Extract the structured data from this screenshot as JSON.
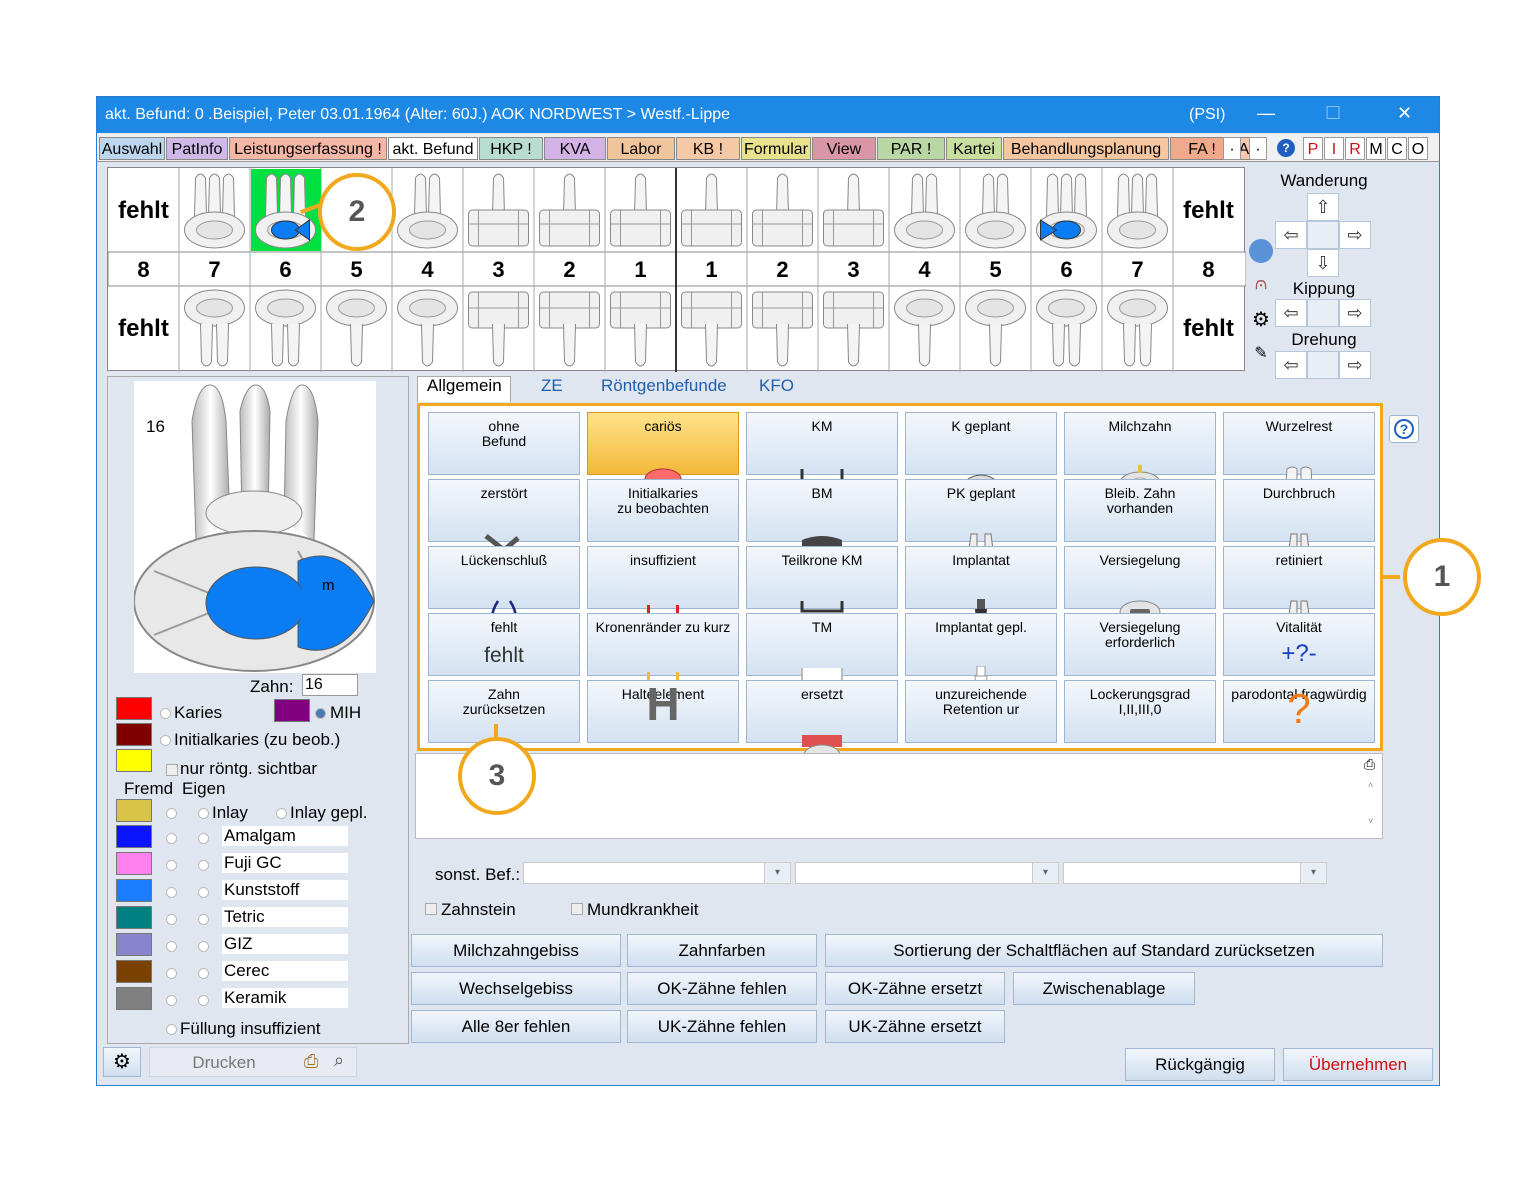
{
  "window": {
    "title": "akt. Befund: 0  .Beispiel, Peter  03.01.1964 (Alter: 60J.)  AOK NORDWEST > Westf.-Lippe",
    "psi": "(PSI)",
    "controls": [
      "—",
      "☐",
      "✕"
    ]
  },
  "tabs": [
    {
      "label": "Auswahl",
      "color": "#bcd6ee"
    },
    {
      "label": "PatInfo",
      "color": "#cfb8e8"
    },
    {
      "label": "Leistungserfassung !",
      "color": "#f4b7a6"
    },
    {
      "label": "akt. Befund",
      "color": "#ffffff"
    },
    {
      "label": "HKP !",
      "color": "#b8dccf"
    },
    {
      "label": "KVA",
      "color": "#d3b3e6"
    },
    {
      "label": "Labor",
      "color": "#f1c59b"
    },
    {
      "label": "KB !",
      "color": "#f5c9a6"
    },
    {
      "label": "Formular",
      "color": "#e9e28c"
    },
    {
      "label": "View",
      "color": "#d896a6"
    },
    {
      "label": "PAR !",
      "color": "#b8d7a4"
    },
    {
      "label": "Kartei",
      "color": "#c9df9d"
    },
    {
      "label": "Behandlungsplanung",
      "color": "#f5c6a0"
    },
    {
      "label": "FA !",
      "color": "#f0a98a"
    },
    {
      "label": "AI",
      "color": "#f7c7ae"
    }
  ],
  "tab_scroll": [
    "·",
    "·"
  ],
  "right_letters": [
    "P",
    "I",
    "R",
    "M",
    "C",
    "O"
  ],
  "chart": {
    "missing_label": "fehlt",
    "numbers": [
      "8",
      "7",
      "6",
      "5",
      "4",
      "3",
      "2",
      "1",
      "1",
      "2",
      "3",
      "4",
      "5",
      "6",
      "7",
      "8"
    ]
  },
  "movement": {
    "wanderung": "Wanderung",
    "kippung": "Kippung",
    "drehung": "Drehung"
  },
  "tooth_detail": {
    "number": "16",
    "surface_label": "m",
    "zahn_label": "Zahn:",
    "zahn_value": "16"
  },
  "legend": {
    "karies": "Karies",
    "mih": "MIH",
    "initialkaries": "Initialkaries (zu beob.)",
    "nur_roentg": "nur röntg. sichtbar",
    "fremd": "Fremd",
    "eigen": "Eigen",
    "inlay": "Inlay",
    "inlay_gepl": "Inlay gepl.",
    "materials": [
      {
        "name": "Amalgam",
        "color": "#0a14ff"
      },
      {
        "name": "Fuji GC",
        "color": "#ff80ee"
      },
      {
        "name": "Kunststoff",
        "color": "#1a7dff"
      },
      {
        "name": "Tetric",
        "color": "#008080"
      },
      {
        "name": "GIZ",
        "color": "#8a84cc"
      },
      {
        "name": "Cerec",
        "color": "#7a4000"
      },
      {
        "name": "Keramik",
        "color": "#808080"
      }
    ],
    "fuellung": "Füllung insuffizient",
    "colors": {
      "karies": "#ff0000",
      "mih": "#800080",
      "initial": "#800000",
      "nur": "#ffff00",
      "inlay": "#d9c44a"
    }
  },
  "subtabs": [
    "Allgemein",
    "ZE",
    "Röntgenbefunde",
    "KFO"
  ],
  "grid_buttons": [
    [
      "ohne\nBefund",
      "cariös",
      "KM",
      "K geplant",
      "Milchzahn",
      "Wurzelrest"
    ],
    [
      "zerstört",
      "Initialkaries\nzu beobachten",
      "BM",
      "PK geplant",
      "Bleib. Zahn\nvorhanden",
      "Durchbruch"
    ],
    [
      "Lückenschluß",
      "insuffizient",
      "Teilkrone KM",
      "Implantat",
      "Versiegelung",
      "retiniert"
    ],
    [
      "fehlt",
      "Kronenränder zu kurz",
      "TM",
      "Implantat gepl.",
      "Versiegelung\nerforderlich",
      "Vitalität"
    ],
    [
      "Zahn\nzurücksetzen",
      "Halteelement",
      "ersetzt",
      "unzureichende\nRetention ur",
      "Lockerungsgrad\nI,II,III,0",
      "parodontal fragwürdig"
    ]
  ],
  "grid_glyphs": {
    "fehlt": "fehlt",
    "vitalitaet": "+?-",
    "parodontal": "?",
    "halteelement": "H"
  },
  "sonst_label": "sonst. Bef.:",
  "checkboxes": {
    "zahnstein": "Zahnstein",
    "mundkrankheit": "Mundkrankheit"
  },
  "action_buttons": {
    "milchzahngebiss": "Milchzahngebiss",
    "zahnfarben": "Zahnfarben",
    "sortierung": "Sortierung der Schaltflächen auf Standard zurücksetzen",
    "wechselgebiss": "Wechselgebiss",
    "ok_fehlen": "OK-Zähne fehlen",
    "ok_ersetzt": "OK-Zähne ersetzt",
    "zwischenablage": "Zwischenablage",
    "alle8er": "Alle 8er fehlen",
    "uk_fehlen": "UK-Zähne fehlen",
    "uk_ersetzt": "UK-Zähne ersetzt"
  },
  "bottom": {
    "drucken": "Drucken",
    "rueckgaengig": "Rückgängig",
    "uebernehmen": "Übernehmen"
  },
  "callouts": [
    "1",
    "2",
    "3"
  ],
  "help": "?"
}
